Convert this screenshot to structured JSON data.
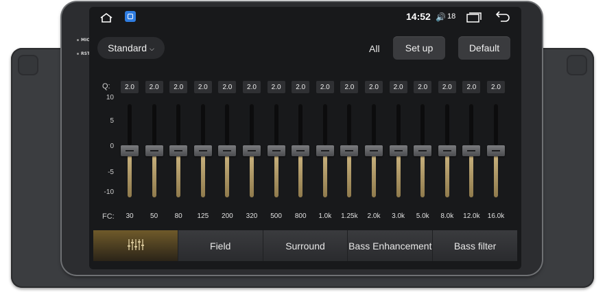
{
  "side_labels": [
    "MIC",
    "RST"
  ],
  "status": {
    "time": "14:52",
    "volume": "18"
  },
  "toolbar": {
    "preset": "Standard",
    "all_label": "All",
    "setup_label": "Set up",
    "default_label": "Default"
  },
  "eq": {
    "q_label": "Q:",
    "fc_label": "FC:",
    "scale": [
      "10",
      "5",
      "0",
      "-5",
      "-10"
    ],
    "bands": [
      {
        "q": "2.0",
        "fc": "30",
        "gain": 0
      },
      {
        "q": "2.0",
        "fc": "50",
        "gain": 0
      },
      {
        "q": "2.0",
        "fc": "80",
        "gain": 0
      },
      {
        "q": "2.0",
        "fc": "125",
        "gain": 0
      },
      {
        "q": "2.0",
        "fc": "200",
        "gain": 0
      },
      {
        "q": "2.0",
        "fc": "320",
        "gain": 0
      },
      {
        "q": "2.0",
        "fc": "500",
        "gain": 0
      },
      {
        "q": "2.0",
        "fc": "800",
        "gain": 0
      },
      {
        "q": "2.0",
        "fc": "1.0k",
        "gain": 0
      },
      {
        "q": "2.0",
        "fc": "1.25k",
        "gain": 0
      },
      {
        "q": "2.0",
        "fc": "2.0k",
        "gain": 0
      },
      {
        "q": "2.0",
        "fc": "3.0k",
        "gain": 0
      },
      {
        "q": "2.0",
        "fc": "5.0k",
        "gain": 0
      },
      {
        "q": "2.0",
        "fc": "8.0k",
        "gain": 0
      },
      {
        "q": "2.0",
        "fc": "12.0k",
        "gain": 0
      },
      {
        "q": "2.0",
        "fc": "16.0k",
        "gain": 0
      }
    ]
  },
  "tabs": [
    {
      "label": "",
      "icon": "equalizer-icon",
      "active": true
    },
    {
      "label": "Field",
      "active": false
    },
    {
      "label": "Surround",
      "active": false
    },
    {
      "label": "Bass Enhancement",
      "active": false
    },
    {
      "label": "Bass filter",
      "active": false
    }
  ]
}
